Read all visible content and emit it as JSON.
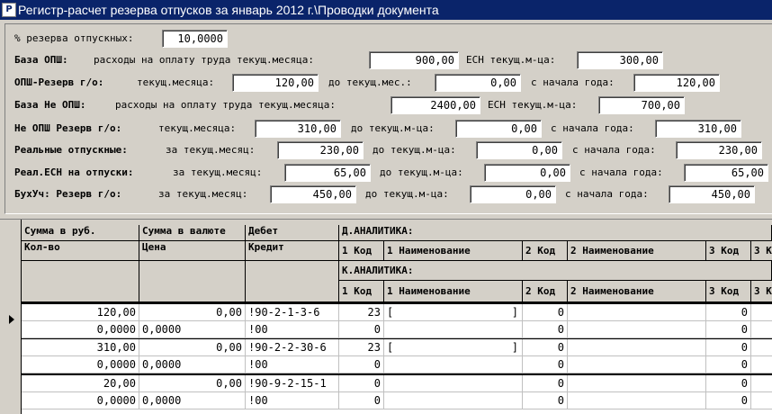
{
  "window": {
    "title": "Регистр-расчет резерва отпусков  за январь 2012 г.\\Проводки документа",
    "icon": "app-icon"
  },
  "form": {
    "reserve_pct_label": "% резерва отпускных:",
    "reserve_pct_value": "10,0000",
    "base_opsh": {
      "title": "База ОПШ:",
      "label1": "расходы на  оплату труда текущ.месяца:",
      "value1": "900,00",
      "label2": "ЕСН текущ.м-ца:",
      "value2": "300,00"
    },
    "opsh_reserve": {
      "title": "ОПШ-Резерв г/о:",
      "label1": "текущ.месяца:",
      "value1": "120,00",
      "label2": "до текущ.мес.:",
      "value2": "0,00",
      "label3": "с начала года:",
      "value3": "120,00"
    },
    "base_not_opsh": {
      "title": "База Не ОПШ:",
      "label1": "расходы на  оплату труда текущ.месяца:",
      "value1": "2400,00",
      "label2": "ЕСН текущ.м-ца:",
      "value2": "700,00"
    },
    "not_opsh_reserve": {
      "title": "Не ОПШ Резерв г/о:",
      "label1": "текущ.месяца:",
      "value1": "310,00",
      "label2": "до текущ.м-ца:",
      "value2": "0,00",
      "label3": "с начала года:",
      "value3": "310,00"
    },
    "real_vacation": {
      "title": "Реальные отпускные:",
      "label1": "за текущ.месяц:",
      "value1": "230,00",
      "label2": "до текущ.м-ца:",
      "value2": "0,00",
      "label3": "с начала года:",
      "value3": "230,00"
    },
    "real_esn": {
      "title": "Реал.ЕСН на отпуски:",
      "label1": "за текущ.месяц:",
      "value1": "65,00",
      "label2": "до текущ.м-ца:",
      "value2": "0,00",
      "label3": "с начала года:",
      "value3": "65,00"
    },
    "buh_reserve": {
      "title": "БухУч: Резерв г/о:",
      "label1": "за текущ.месяц:",
      "value1": "450,00",
      "label2": "до текущ.м-ца:",
      "value2": "0,00",
      "label3": "с начала года:",
      "value3": "450,00"
    }
  },
  "grid": {
    "headers": {
      "sum_rub": "Сумма в руб.",
      "sum_cur": "Сумма в валюте",
      "debit": "Дебет",
      "d_analytics": "Д.АНАЛИТИКА:",
      "qty": "Кол-во",
      "price": "Цена",
      "credit": "Кредит",
      "k_analytics": "К.АНАЛИТИКА:",
      "code1": "1 Код",
      "name1": "1 Наименование",
      "code2": "2 Код",
      "name2": "2 Наименование",
      "code3": "3 Код",
      "code3_cut": "3 К"
    },
    "entries": [
      {
        "sum_rub": "120,00",
        "sum_cur": "0,00",
        "debit": "!90-2-1-3-6",
        "d1": "23",
        "d1name": "[",
        "d1name_end": "]",
        "d2": "0",
        "d3": "0",
        "qty": "0,0000",
        "price": "0,0000",
        "credit": "!00",
        "k1": "0",
        "k2": "0",
        "k3": "0"
      },
      {
        "sum_rub": "310,00",
        "sum_cur": "0,00",
        "debit": "!90-2-2-30-6",
        "d1": "23",
        "d1name": "[",
        "d1name_end": "]",
        "d2": "0",
        "d3": "0",
        "qty": "0,0000",
        "price": "0,0000",
        "credit": "!00",
        "k1": "0",
        "k2": "0",
        "k3": "0"
      },
      {
        "sum_rub": "20,00",
        "sum_cur": "0,00",
        "debit": "!90-9-2-15-1",
        "d1": "0",
        "d1name": "",
        "d1name_end": "",
        "d2": "0",
        "d3": "0",
        "qty": "0,0000",
        "price": "0,0000",
        "credit": "!00",
        "k1": "0",
        "k2": "0",
        "k3": "0"
      }
    ]
  }
}
